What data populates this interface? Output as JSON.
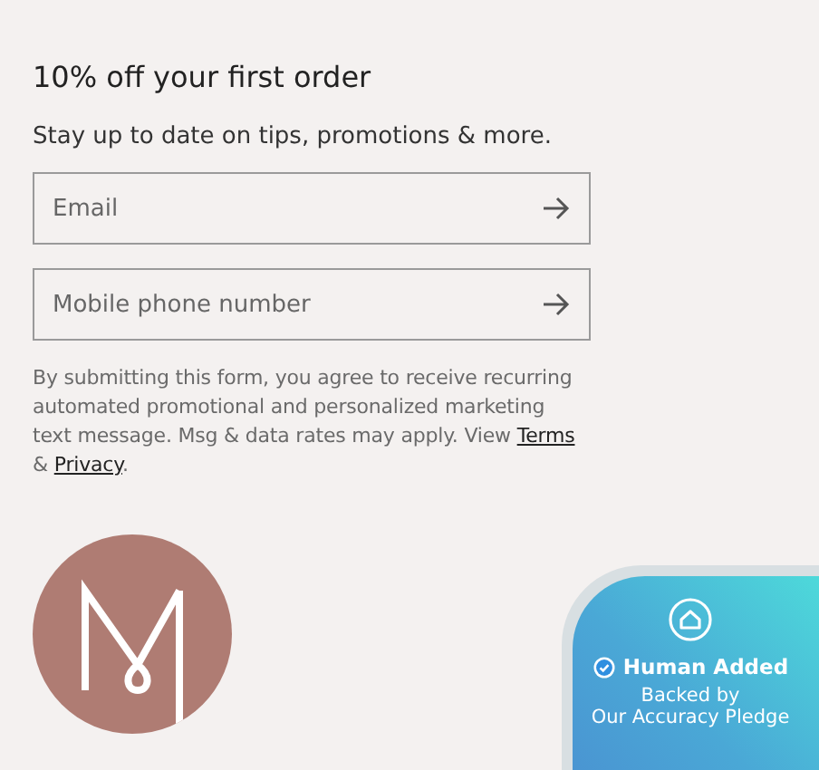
{
  "signup": {
    "title": "10% off your first order",
    "subtitle": "Stay up to date on tips, promotions & more.",
    "fields": [
      {
        "placeholder": "Email"
      },
      {
        "placeholder": "Mobile phone number"
      }
    ],
    "disclaimer": {
      "text": "By submitting this form, you agree to receive recurring automated promotional and personalized marketing text message. Msg & data rates may apply. View ",
      "terms_link": "Terms",
      "joiner": " & ",
      "privacy_link": "Privacy",
      "end": "."
    }
  },
  "badge": {
    "title": "Human Added",
    "lines": [
      "Backed by",
      "Our Accuracy Pledge"
    ]
  }
}
